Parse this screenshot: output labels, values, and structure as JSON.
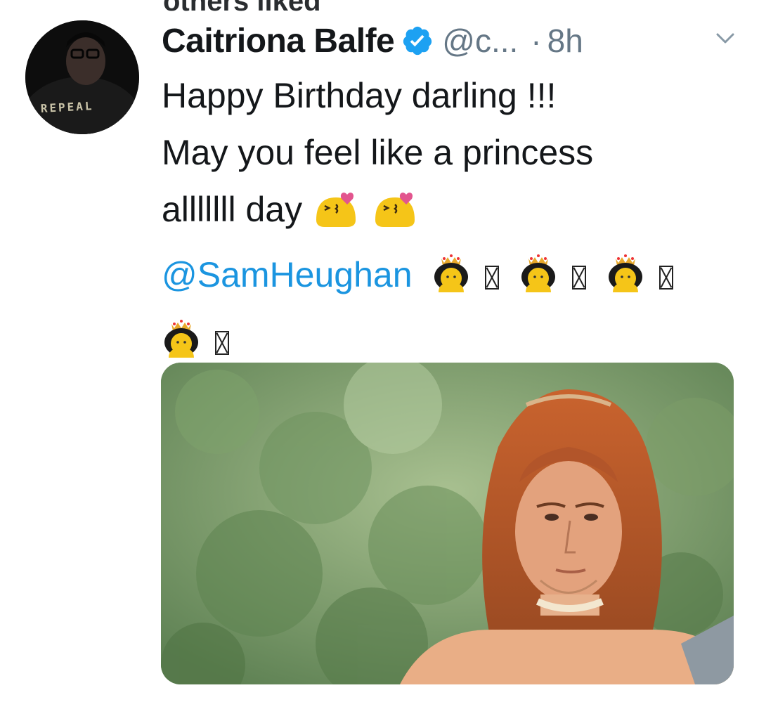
{
  "top_context": "others liked",
  "tweet": {
    "author_name": "Caitriona Balfe",
    "handle": "@c...",
    "separator": "·",
    "time": "8h",
    "verified": true,
    "text_line1": "Happy Birthday darling !!!",
    "text_line2": "May you feel like a princess",
    "text_line3": "alllllll day",
    "mention": "@SamHeughan",
    "avatar_shirt_text": "REPEAL"
  },
  "icons": {
    "verified": "verified-badge-icon",
    "caret": "chevron-down-icon",
    "kiss_emoji": "kissing-heart-emoji",
    "princess_emoji": "princess-emoji",
    "missing_glyph": "missing-glyph-box"
  },
  "colors": {
    "text": "#14171a",
    "secondary": "#657786",
    "link": "#1b95e0",
    "verified": "#1da1f2"
  }
}
